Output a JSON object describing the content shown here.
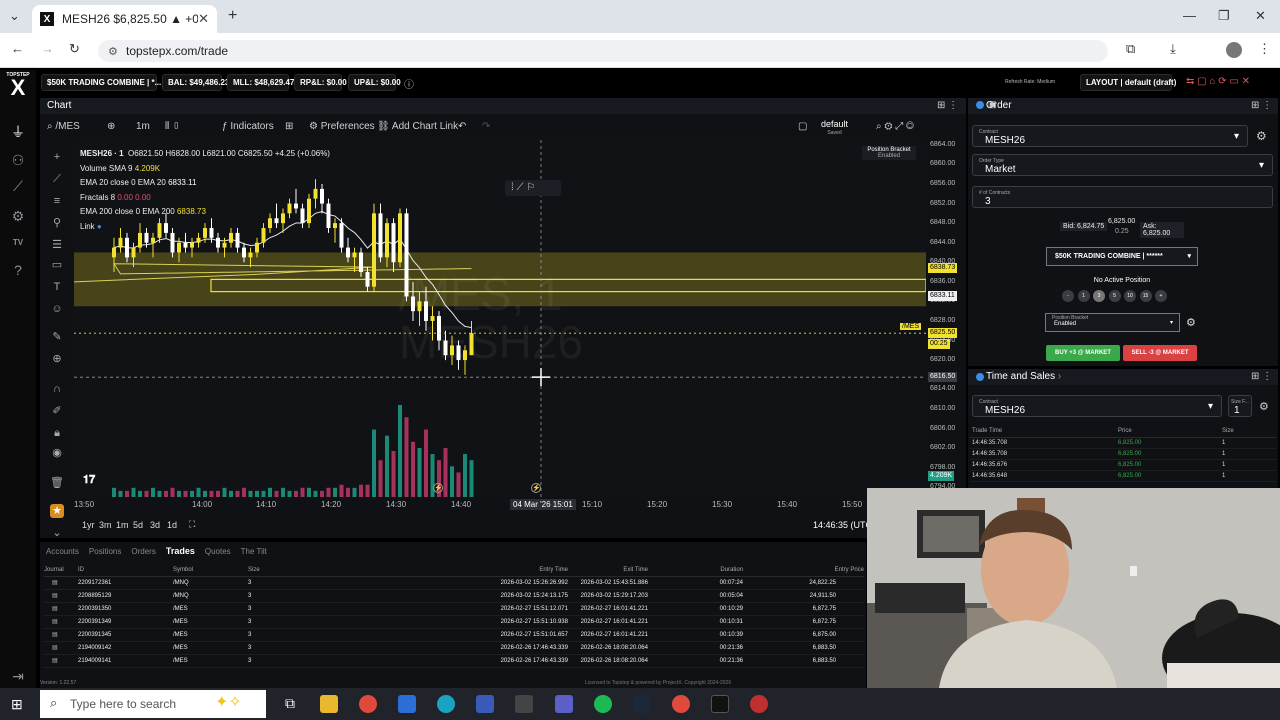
{
  "browser": {
    "tab_title": "MESH26 $6,825.50 ▲ +0.01%",
    "url": "topstepx.com/trade",
    "tab_favicon": "X"
  },
  "app": {
    "logo_text": "TOPSTEP",
    "logo_mark": "X",
    "account_select": "$50K TRADING COMBINE | *...",
    "bal": "BAL: $49,486.23",
    "mll": "MLL: $48,629.47",
    "rpl": "RP&L: $0.00",
    "upl": "UP&L: $0.00",
    "latency": "Refresh Rate: Medium",
    "layout": "LAYOUT | default (draft)",
    "version": "Version: 1.22.57"
  },
  "chart": {
    "panel_title": "Chart",
    "symbol_search": "/MES",
    "timeframe": "1m",
    "tools": {
      "indicators": "Indicators",
      "preferences": "Preferences",
      "add_chart_link": "Add Chart Link",
      "template": "default",
      "template_sub": "Saved"
    },
    "legend": {
      "symbol": "MESH26 · 1",
      "ohlc": "O6821.50 H6828.00 L6821.00 C6825.50 +4.25 (+0.06%)",
      "volume": "Volume SMA 9",
      "volume_val": "4.209K",
      "ema20": "EMA 20 close 0 EMA 20",
      "ema20_val": "6833.11",
      "fractals": "Fractals 8",
      "fractals_vals": "0.00  0.00",
      "ema200": "EMA 200 close 0 EMA 200",
      "ema200_val": "6838.73",
      "link": "Link"
    },
    "position_bracket": "Position Bracket",
    "position_bracket_state": "Enabled",
    "watermark_line1": "/MES, 1",
    "watermark_line2": "MESH26",
    "price_labels": [
      "6864.00",
      "6860.00",
      "6856.00",
      "6852.00",
      "6848.00",
      "6844.00",
      "6840.00",
      "6836.00",
      "6832.00",
      "6828.00",
      "6824.00",
      "6820.00",
      "6816.00",
      "6814.00",
      "6810.00",
      "6806.00",
      "6802.00",
      "6798.00",
      "6794.00"
    ],
    "tag_ema200": "6838.73",
    "tag_ema20": "6833.11",
    "tag_last": "6825.50",
    "tag_timer": "00:25",
    "tag_cursor": "6816.50",
    "tag_vol": "4.209K",
    "tag_sym": "/MES",
    "time_labels": [
      "13:50",
      "14:00",
      "14:10",
      "14:20",
      "14:30",
      "14:40",
      "14:50",
      "15:10",
      "15:20",
      "15:30",
      "15:40",
      "15:50"
    ],
    "cursor_time": "04 Mar '26  15:01",
    "timeframes": [
      "1yr",
      "3m",
      "1m",
      "5d",
      "3d",
      "1d"
    ],
    "clock": "14:46:35 (UTC",
    "colors": {
      "up": "#f2e12e",
      "down": "#ffffff",
      "zone": "#59561b",
      "vol_up": "#1f9e87",
      "vol_down": "#c2376a"
    },
    "candles": [
      [
        6841,
        6845,
        6838,
        6843
      ],
      [
        6843,
        6847,
        6842,
        6845
      ],
      [
        6845,
        6846,
        6840,
        6841
      ],
      [
        6841,
        6844,
        6839,
        6843
      ],
      [
        6843,
        6848,
        6842,
        6846
      ],
      [
        6846,
        6847,
        6843,
        6844
      ],
      [
        6844,
        6846,
        6841,
        6845
      ],
      [
        6845,
        6849,
        6844,
        6848
      ],
      [
        6848,
        6850,
        6845,
        6846
      ],
      [
        6846,
        6847,
        6841,
        6842
      ],
      [
        6842,
        6845,
        6840,
        6844
      ],
      [
        6844,
        6846,
        6842,
        6843
      ],
      [
        6843,
        6845,
        6841,
        6844
      ],
      [
        6844,
        6846,
        6843,
        6845
      ],
      [
        6845,
        6848,
        6844,
        6847
      ],
      [
        6847,
        6849,
        6844,
        6845
      ],
      [
        6845,
        6846,
        6842,
        6843
      ],
      [
        6843,
        6845,
        6841,
        6844
      ],
      [
        6844,
        6847,
        6843,
        6846
      ],
      [
        6846,
        6847,
        6842,
        6843
      ],
      [
        6843,
        6844,
        6840,
        6841
      ],
      [
        6841,
        6843,
        6839,
        6842
      ],
      [
        6842,
        6845,
        6841,
        6844
      ],
      [
        6844,
        6848,
        6843,
        6847
      ],
      [
        6847,
        6850,
        6846,
        6849
      ],
      [
        6849,
        6852,
        6847,
        6848
      ],
      [
        6848,
        6851,
        6846,
        6850
      ],
      [
        6850,
        6853,
        6849,
        6852
      ],
      [
        6852,
        6855,
        6850,
        6851
      ],
      [
        6851,
        6852,
        6847,
        6848
      ],
      [
        6848,
        6854,
        6847,
        6853
      ],
      [
        6853,
        6857,
        6851,
        6855
      ],
      [
        6855,
        6856,
        6850,
        6852
      ],
      [
        6852,
        6853,
        6846,
        6847
      ],
      [
        6847,
        6849,
        6844,
        6848
      ],
      [
        6848,
        6849,
        6842,
        6843
      ],
      [
        6843,
        6845,
        6840,
        6841
      ],
      [
        6841,
        6843,
        6838,
        6842
      ],
      [
        6842,
        6843,
        6837,
        6838
      ],
      [
        6838,
        6839,
        6834,
        6835
      ],
      [
        6835,
        6852,
        6834,
        6850
      ],
      [
        6850,
        6852,
        6840,
        6841
      ],
      [
        6841,
        6849,
        6839,
        6848
      ],
      [
        6848,
        6849,
        6838,
        6840
      ],
      [
        6840,
        6851,
        6839,
        6850
      ],
      [
        6850,
        6851,
        6832,
        6833
      ],
      [
        6833,
        6836,
        6828,
        6830
      ],
      [
        6830,
        6834,
        6827,
        6832
      ],
      [
        6832,
        6835,
        6826,
        6828
      ],
      [
        6828,
        6831,
        6824,
        6829
      ],
      [
        6829,
        6830,
        6822,
        6824
      ],
      [
        6824,
        6826,
        6820,
        6821
      ],
      [
        6821,
        6825,
        6819,
        6823
      ],
      [
        6823,
        6824,
        6818,
        6820
      ],
      [
        6820,
        6823,
        6817,
        6822
      ],
      [
        6821,
        6828,
        6821,
        6825.5
      ]
    ],
    "volumes": [
      3,
      2,
      2,
      3,
      2,
      2,
      3,
      2,
      2,
      3,
      2,
      2,
      2,
      3,
      2,
      2,
      2,
      3,
      2,
      2,
      3,
      2,
      2,
      2,
      3,
      2,
      3,
      2,
      2,
      3,
      3,
      2,
      2,
      3,
      3,
      4,
      3,
      3,
      4,
      4,
      22,
      12,
      20,
      15,
      30,
      26,
      18,
      16,
      22,
      14,
      12,
      16,
      10,
      8,
      14,
      12
    ]
  },
  "order": {
    "title": "Order",
    "contract_label": "Contract",
    "contract": "MESH26",
    "order_type_label": "Order Type",
    "order_type": "Market",
    "contracts_label": "# of Contracts",
    "contracts": "3",
    "bid": "Bid: 6,824.75",
    "last": "6,825.00",
    "spread": "0.25",
    "ask": "Ask: 6,825.00",
    "account": "$50K TRADING COMBINE | ******",
    "position": "No Active Position",
    "qty_buttons": [
      "-",
      "1",
      "3",
      "5",
      "10",
      "15",
      "+"
    ],
    "bracket_label": "Position Bracket",
    "bracket": "Enabled",
    "buy": "BUY +3 @ MARKET",
    "sell": "SELL -3 @ MARKET"
  },
  "time_sales": {
    "title": "Time and Sales",
    "contract_label": "Contract",
    "contract": "MESH26",
    "size_label": "Size F...",
    "size": "1",
    "headers": [
      "Trade Time",
      "Price",
      "Size"
    ],
    "rows": [
      [
        "14:46:35.708",
        "6,825.00",
        "1"
      ],
      [
        "14:46:35.708",
        "6,825.00",
        "1"
      ],
      [
        "14:46:35.676",
        "6,825.00",
        "1"
      ],
      [
        "14:46:35.648",
        "6,825.00",
        "1"
      ]
    ]
  },
  "bottom": {
    "tabs": [
      "Accounts",
      "Positions",
      "Orders",
      "Trades",
      "Quotes",
      "The Tilt"
    ],
    "active_tab": "Trades",
    "headers": [
      "Journal",
      "ID",
      "Symbol",
      "Size",
      "Entry Time",
      "Exit Time",
      "Duration",
      "Entry Price"
    ],
    "rows": [
      [
        "2209172361",
        "/MNQ",
        "3",
        "2026-03-02 15:26:26.992",
        "2026-03-02 15:43:51.886",
        "00:07:24",
        "24,822.25"
      ],
      [
        "2208895129",
        "/MNQ",
        "3",
        "2026-03-02 15:24:13.175",
        "2026-03-02 15:29:17.203",
        "00:05:04",
        "24,911.50"
      ],
      [
        "2200391350",
        "/MES",
        "3",
        "2026-02-27 15:51:12.071",
        "2026-02-27 16:01:41.221",
        "00:10:29",
        "6,872.75"
      ],
      [
        "2200391349",
        "/MES",
        "3",
        "2026-02-27 15:51:10.938",
        "2026-02-27 16:01:41.221",
        "00:10:31",
        "6,872.75"
      ],
      [
        "2200391345",
        "/MES",
        "3",
        "2026-02-27 15:51:01.657",
        "2026-02-27 16:01:41.221",
        "00:10:39",
        "6,875.00"
      ],
      [
        "2194009142",
        "/MES",
        "3",
        "2026-02-26 17:46:43.339",
        "2026-02-26 18:08:20.064",
        "00:21:36",
        "6,883.50"
      ],
      [
        "2194009141",
        "/MES",
        "3",
        "2026-02-26 17:46:43.339",
        "2026-02-26 18:08:20.064",
        "00:21:36",
        "6,883.50"
      ]
    ],
    "footer": "Licensed to Topstep & powered by ProjectX. Copyright 2024-2026"
  },
  "taskbar": {
    "search_placeholder": "Type here to search"
  }
}
